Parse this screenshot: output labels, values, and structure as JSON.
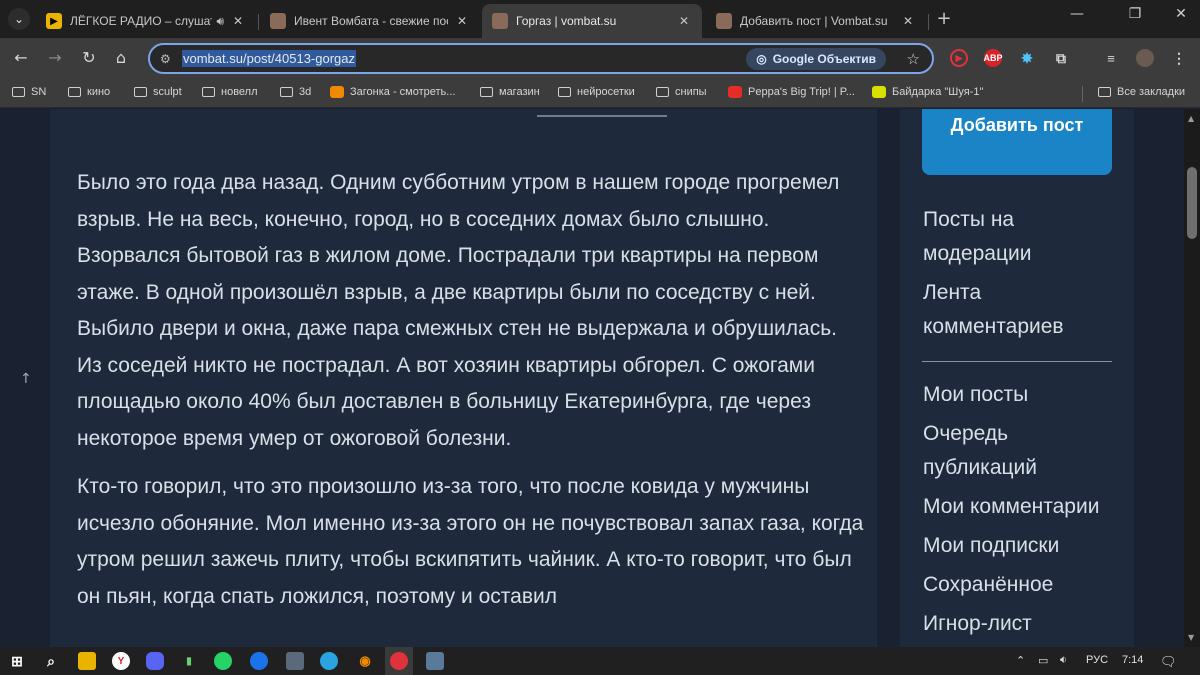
{
  "tabs": [
    {
      "title": "ЛЁГКОЕ РАДИО – слушать",
      "icon": "youtube-music-icon",
      "has_audio": true
    },
    {
      "title": "Ивент Вомбата - свежие пост",
      "icon": "wombat-icon",
      "has_audio": false
    },
    {
      "title": "Горгаз | vombat.su",
      "icon": "wombat-icon",
      "has_audio": false,
      "active": true
    },
    {
      "title": "Добавить пост | Vombat.su",
      "icon": "wombat-icon",
      "has_audio": false
    }
  ],
  "toolbar": {
    "url": "vombat.su/post/40513-gorgaz",
    "lens_label": "Google Объектив",
    "abp_label": "ABP"
  },
  "bookmarks": [
    {
      "label": "SN",
      "type": "folder"
    },
    {
      "label": "кино",
      "type": "folder"
    },
    {
      "label": "sculpt",
      "type": "folder"
    },
    {
      "label": "новелл",
      "type": "folder"
    },
    {
      "label": "3d",
      "type": "folder"
    },
    {
      "label": "Загонка - смотреть...",
      "type": "site"
    },
    {
      "label": "магазин",
      "type": "folder"
    },
    {
      "label": "нейросетки",
      "type": "folder"
    },
    {
      "label": "снипы",
      "type": "folder"
    },
    {
      "label": "Peppa's Big Trip! | P...",
      "type": "site"
    },
    {
      "label": "Байдарка \"Шуя-1\"",
      "type": "site"
    },
    {
      "label": "Все закладки",
      "type": "folder"
    }
  ],
  "article": {
    "paragraphs": [
      "Было это года два назад. Одним субботним утром в нашем городе прогремел взрыв. Не на весь, конечно, город, но в соседних домах было слышно. Взорвался бытовой газ в жилом доме. Пострадали три квартиры на первом этаже. В одной произошёл взрыв, а две квартиры были по соседству с ней. Выбило двери и окна, даже пара смежных стен не выдержала и обрушилась. Из соседей никто не пострадал. А вот хозяин квартиры обгорел. С ожогами площадью около 40% был доставлен в больницу Екатеринбурга, где через некоторое время умер от ожоговой болезни.",
      "Кто-то говорил, что это произошло из-за того, что после ковида у мужчины исчезло обоняние. Мол именно из-за этого он не почувствовал запах газа, когда утром решил зажечь плиту, чтобы вскипятить чайник. А кто-то говорит, что был он пьян, когда спать ложился, поэтому и оставил"
    ]
  },
  "sidebar": {
    "add_post_label": "Добавить пост",
    "group1": [
      "Посты на модерации",
      "Лента комментариев"
    ],
    "group2": [
      "Мои посты",
      "Очередь публикаций",
      "Мои комментарии",
      "Мои подписки",
      "Сохранённое",
      "Игнор-лист"
    ]
  },
  "taskbar": {
    "lang": "РУС",
    "time": "7:14"
  },
  "colors": {
    "page_bg": "#1a2232",
    "card_bg": "#1e2a3c",
    "accent": "#1a84c7",
    "text": "#d9dfe8"
  }
}
